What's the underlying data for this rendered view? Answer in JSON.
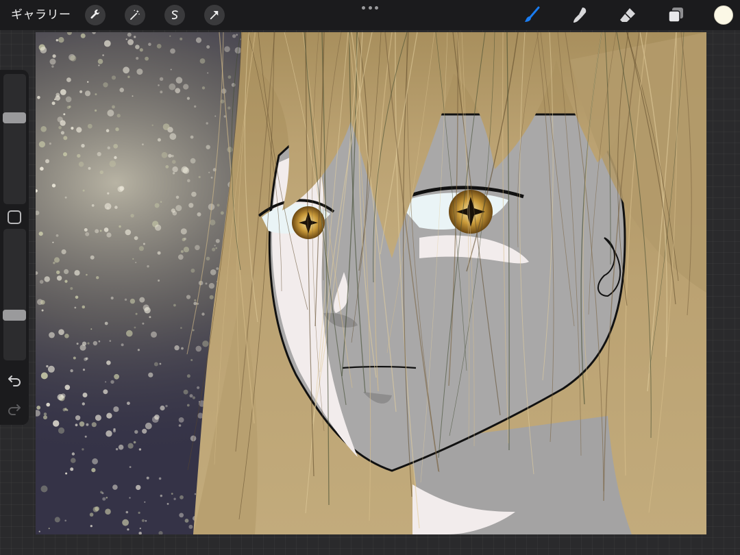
{
  "toolbar": {
    "gallery_label": "ギャラリー",
    "left_tools": [
      {
        "name": "actions",
        "icon": "wrench-icon"
      },
      {
        "name": "adjustments",
        "icon": "magic-wand-icon"
      },
      {
        "name": "selection",
        "icon": "selection-s-icon"
      },
      {
        "name": "transform",
        "icon": "arrow-cursor-icon"
      }
    ],
    "right_tools": [
      {
        "name": "brush",
        "icon": "brush-icon",
        "active": true
      },
      {
        "name": "smudge",
        "icon": "smudge-finger-icon"
      },
      {
        "name": "eraser",
        "icon": "eraser-icon"
      },
      {
        "name": "layers",
        "icon": "layers-icon"
      }
    ],
    "current_color": "#fbf8e6",
    "active_color": "#1a7cf0"
  },
  "sidebar": {
    "brush_size_level": 0.32,
    "opacity_level": 0.67,
    "undo_icon": "undo-arrow-icon",
    "redo_icon": "redo-arrow-icon"
  },
  "canvas": {
    "palette": {
      "background": "#353347",
      "hair": "#b39a6a",
      "skin": "#a9a8a8",
      "highlight": "#f2ecec",
      "eye": "#c99a3a"
    }
  }
}
